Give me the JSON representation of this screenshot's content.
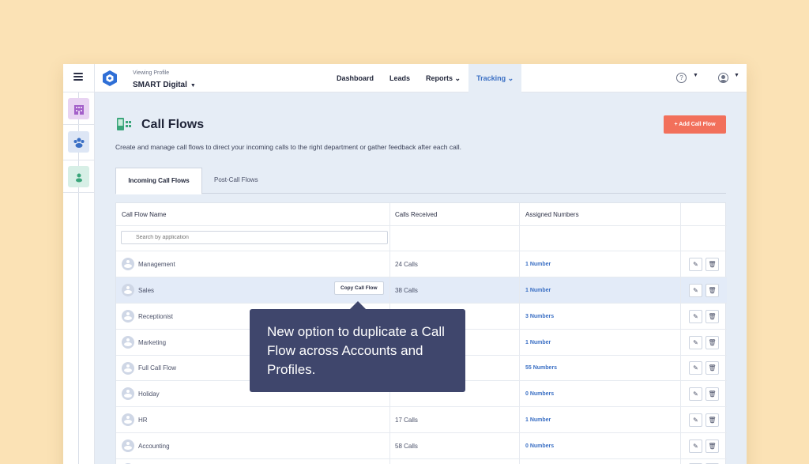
{
  "topbar": {
    "viewing_label": "Viewing Profile",
    "profile_name": "SMART Digital",
    "nav": [
      {
        "label": "Dashboard"
      },
      {
        "label": "Leads"
      },
      {
        "label": "Reports ⌄"
      },
      {
        "label": "Tracking ⌄"
      }
    ],
    "help_glyph": "?"
  },
  "page": {
    "title": "Call Flows",
    "add_button": "+ Add Call Flow",
    "description": "Create and manage call flows to direct your incoming calls to the right department or gather feedback after each call.",
    "tabs": [
      "Incoming Call Flows",
      "Post-Call Flows"
    ]
  },
  "table": {
    "headers": [
      "Call Flow Name",
      "Calls Received",
      "Assigned Numbers"
    ],
    "search_placeholder": "Search by application",
    "rows": [
      {
        "name": "Management",
        "calls": "24 Calls",
        "numbers": "1 Number"
      },
      {
        "name": "Sales",
        "calls": "38 Calls",
        "numbers": "1 Number"
      },
      {
        "name": "Receptionist",
        "calls": "",
        "numbers": "3 Numbers"
      },
      {
        "name": "Marketing",
        "calls": "",
        "numbers": "1 Number"
      },
      {
        "name": "Full Call Flow",
        "calls": "",
        "numbers": "55 Numbers"
      },
      {
        "name": "Holiday",
        "calls": "",
        "numbers": "0 Numbers"
      },
      {
        "name": "HR",
        "calls": "17 Calls",
        "numbers": "1 Number"
      },
      {
        "name": "Accounting",
        "calls": "58 Calls",
        "numbers": "0 Numbers"
      }
    ],
    "copy_button": "Copy Call Flow"
  },
  "tooltip": {
    "text": "New option to duplicate a Call Flow across Accounts and Profiles."
  },
  "colors": {
    "accent": "#3a6fc4",
    "add_button": "#f2705b",
    "tooltip": "#3f466c",
    "background": "#fbe2b5"
  }
}
